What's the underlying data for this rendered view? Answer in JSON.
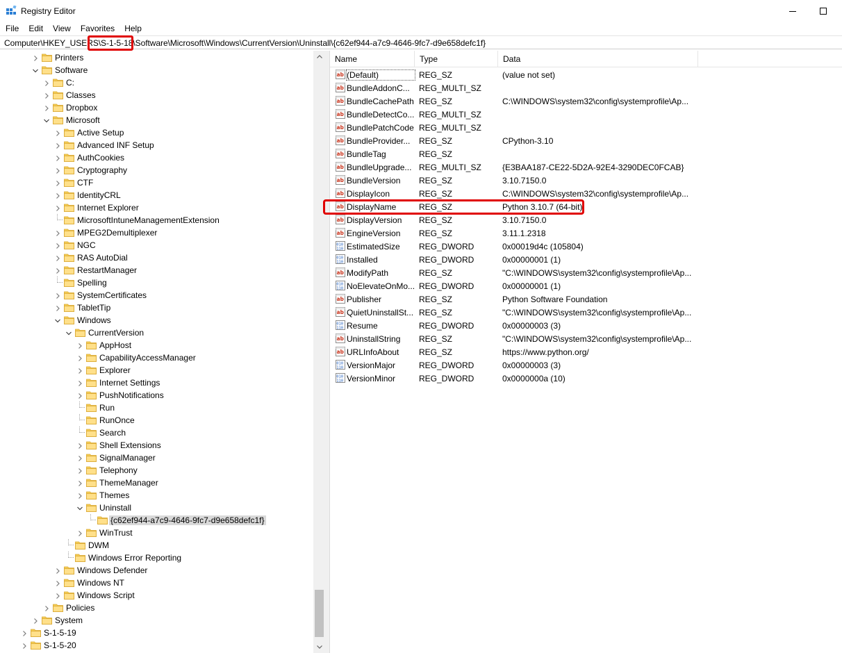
{
  "window": {
    "title": "Registry Editor",
    "minimize_glyph": "—",
    "maximize_glyph": "☐"
  },
  "menu": [
    "File",
    "Edit",
    "View",
    "Favorites",
    "Help"
  ],
  "address": {
    "path": "Computer\\HKEY_USERS\\S-1-5-18\\Software\\Microsoft\\Windows\\CurrentVersion\\Uninstall\\{c62ef944-a7c9-4646-9fc7-d9e658defc1f}"
  },
  "accent": {
    "highlight": "#e00000",
    "folder": "#f6cf57",
    "selection": "#d9d9d9"
  },
  "tree": [
    {
      "label": "Printers",
      "depth": 2,
      "expander": "collapsed"
    },
    {
      "label": "Software",
      "depth": 2,
      "expander": "expanded"
    },
    {
      "label": "C:",
      "depth": 3,
      "expander": "collapsed"
    },
    {
      "label": "Classes",
      "depth": 3,
      "expander": "collapsed"
    },
    {
      "label": "Dropbox",
      "depth": 3,
      "expander": "collapsed"
    },
    {
      "label": "Microsoft",
      "depth": 3,
      "expander": "expanded"
    },
    {
      "label": "Active Setup",
      "depth": 4,
      "expander": "collapsed"
    },
    {
      "label": "Advanced INF Setup",
      "depth": 4,
      "expander": "collapsed"
    },
    {
      "label": "AuthCookies",
      "depth": 4,
      "expander": "collapsed"
    },
    {
      "label": "Cryptography",
      "depth": 4,
      "expander": "collapsed"
    },
    {
      "label": "CTF",
      "depth": 4,
      "expander": "collapsed"
    },
    {
      "label": "IdentityCRL",
      "depth": 4,
      "expander": "collapsed"
    },
    {
      "label": "Internet Explorer",
      "depth": 4,
      "expander": "collapsed"
    },
    {
      "label": "MicrosoftIntuneManagementExtension",
      "depth": 4,
      "expander": "none"
    },
    {
      "label": "MPEG2Demultiplexer",
      "depth": 4,
      "expander": "collapsed"
    },
    {
      "label": "NGC",
      "depth": 4,
      "expander": "collapsed"
    },
    {
      "label": "RAS AutoDial",
      "depth": 4,
      "expander": "collapsed"
    },
    {
      "label": "RestartManager",
      "depth": 4,
      "expander": "collapsed"
    },
    {
      "label": "Spelling",
      "depth": 4,
      "expander": "none"
    },
    {
      "label": "SystemCertificates",
      "depth": 4,
      "expander": "collapsed"
    },
    {
      "label": "TabletTip",
      "depth": 4,
      "expander": "collapsed"
    },
    {
      "label": "Windows",
      "depth": 4,
      "expander": "expanded"
    },
    {
      "label": "CurrentVersion",
      "depth": 5,
      "expander": "expanded"
    },
    {
      "label": "AppHost",
      "depth": 6,
      "expander": "collapsed"
    },
    {
      "label": "CapabilityAccessManager",
      "depth": 6,
      "expander": "collapsed"
    },
    {
      "label": "Explorer",
      "depth": 6,
      "expander": "collapsed"
    },
    {
      "label": "Internet Settings",
      "depth": 6,
      "expander": "collapsed"
    },
    {
      "label": "PushNotifications",
      "depth": 6,
      "expander": "collapsed"
    },
    {
      "label": "Run",
      "depth": 6,
      "expander": "none"
    },
    {
      "label": "RunOnce",
      "depth": 6,
      "expander": "none"
    },
    {
      "label": "Search",
      "depth": 6,
      "expander": "none"
    },
    {
      "label": "Shell Extensions",
      "depth": 6,
      "expander": "collapsed"
    },
    {
      "label": "SignalManager",
      "depth": 6,
      "expander": "collapsed"
    },
    {
      "label": "Telephony",
      "depth": 6,
      "expander": "collapsed"
    },
    {
      "label": "ThemeManager",
      "depth": 6,
      "expander": "collapsed"
    },
    {
      "label": "Themes",
      "depth": 6,
      "expander": "collapsed"
    },
    {
      "label": "Uninstall",
      "depth": 6,
      "expander": "expanded"
    },
    {
      "label": "{c62ef944-a7c9-4646-9fc7-d9e658defc1f}",
      "depth": 7,
      "expander": "none",
      "selected": true
    },
    {
      "label": "WinTrust",
      "depth": 6,
      "expander": "collapsed"
    },
    {
      "label": "DWM",
      "depth": 5,
      "expander": "none"
    },
    {
      "label": "Windows Error Reporting",
      "depth": 5,
      "expander": "none"
    },
    {
      "label": "Windows Defender",
      "depth": 4,
      "expander": "collapsed"
    },
    {
      "label": "Windows NT",
      "depth": 4,
      "expander": "collapsed"
    },
    {
      "label": "Windows Script",
      "depth": 4,
      "expander": "collapsed"
    },
    {
      "label": "Policies",
      "depth": 3,
      "expander": "collapsed"
    },
    {
      "label": "System",
      "depth": 2,
      "expander": "collapsed"
    },
    {
      "label": "S-1-5-19",
      "depth": 1,
      "expander": "collapsed"
    },
    {
      "label": "S-1-5-20",
      "depth": 1,
      "expander": "collapsed"
    }
  ],
  "values_header": {
    "name": "Name",
    "type": "Type",
    "data": "Data"
  },
  "values": [
    {
      "name": "(Default)",
      "type": "REG_SZ",
      "data": "(value not set)",
      "icon": "string-value-icon"
    },
    {
      "name": "BundleAddonC...",
      "type": "REG_MULTI_SZ",
      "data": "",
      "icon": "string-value-icon"
    },
    {
      "name": "BundleCachePath",
      "type": "REG_SZ",
      "data": "C:\\WINDOWS\\system32\\config\\systemprofile\\Ap...",
      "icon": "string-value-icon"
    },
    {
      "name": "BundleDetectCo...",
      "type": "REG_MULTI_SZ",
      "data": "",
      "icon": "string-value-icon"
    },
    {
      "name": "BundlePatchCode",
      "type": "REG_MULTI_SZ",
      "data": "",
      "icon": "string-value-icon"
    },
    {
      "name": "BundleProvider...",
      "type": "REG_SZ",
      "data": "CPython-3.10",
      "icon": "string-value-icon"
    },
    {
      "name": "BundleTag",
      "type": "REG_SZ",
      "data": "",
      "icon": "string-value-icon"
    },
    {
      "name": "BundleUpgrade...",
      "type": "REG_MULTI_SZ",
      "data": "{E3BAA187-CE22-5D2A-92E4-3290DEC0FCAB}",
      "icon": "string-value-icon"
    },
    {
      "name": "BundleVersion",
      "type": "REG_SZ",
      "data": "3.10.7150.0",
      "icon": "string-value-icon"
    },
    {
      "name": "DisplayIcon",
      "type": "REG_SZ",
      "data": "C:\\WINDOWS\\system32\\config\\systemprofile\\Ap...",
      "icon": "string-value-icon"
    },
    {
      "name": "DisplayName",
      "type": "REG_SZ",
      "data": "Python 3.10.7 (64-bit)",
      "icon": "string-value-icon"
    },
    {
      "name": "DisplayVersion",
      "type": "REG_SZ",
      "data": "3.10.7150.0",
      "icon": "string-value-icon"
    },
    {
      "name": "EngineVersion",
      "type": "REG_SZ",
      "data": "3.11.1.2318",
      "icon": "string-value-icon"
    },
    {
      "name": "EstimatedSize",
      "type": "REG_DWORD",
      "data": "0x00019d4c (105804)",
      "icon": "dword-value-icon"
    },
    {
      "name": "Installed",
      "type": "REG_DWORD",
      "data": "0x00000001 (1)",
      "icon": "dword-value-icon"
    },
    {
      "name": "ModifyPath",
      "type": "REG_SZ",
      "data": "\"C:\\WINDOWS\\system32\\config\\systemprofile\\Ap...",
      "icon": "string-value-icon"
    },
    {
      "name": "NoElevateOnMo...",
      "type": "REG_DWORD",
      "data": "0x00000001 (1)",
      "icon": "dword-value-icon"
    },
    {
      "name": "Publisher",
      "type": "REG_SZ",
      "data": "Python Software Foundation",
      "icon": "string-value-icon"
    },
    {
      "name": "QuietUninstallSt...",
      "type": "REG_SZ",
      "data": "\"C:\\WINDOWS\\system32\\config\\systemprofile\\Ap...",
      "icon": "string-value-icon"
    },
    {
      "name": "Resume",
      "type": "REG_DWORD",
      "data": "0x00000003 (3)",
      "icon": "dword-value-icon"
    },
    {
      "name": "UninstallString",
      "type": "REG_SZ",
      "data": "\"C:\\WINDOWS\\system32\\config\\systemprofile\\Ap...",
      "icon": "string-value-icon"
    },
    {
      "name": "URLInfoAbout",
      "type": "REG_SZ",
      "data": "https://www.python.org/",
      "icon": "string-value-icon"
    },
    {
      "name": "VersionMajor",
      "type": "REG_DWORD",
      "data": "0x00000003 (3)",
      "icon": "dword-value-icon"
    },
    {
      "name": "VersionMinor",
      "type": "REG_DWORD",
      "data": "0x0000000a (10)",
      "icon": "dword-value-icon"
    }
  ]
}
